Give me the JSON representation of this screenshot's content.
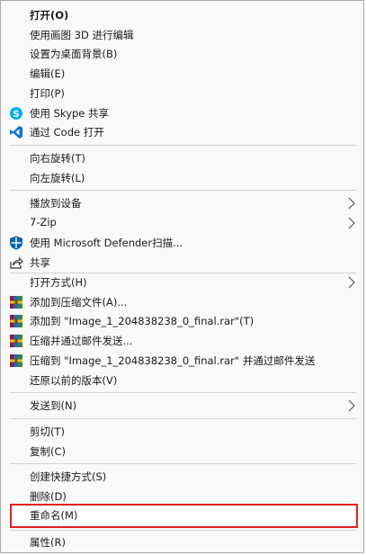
{
  "menu": {
    "items": [
      {
        "label": "打开(O)"
      },
      {
        "label": "使用画图 3D 进行编辑"
      },
      {
        "label": "设置为桌面背景(B)"
      },
      {
        "label": "编辑(E)"
      },
      {
        "label": "打印(P)"
      },
      {
        "label": "使用 Skype 共享",
        "icon": "skype-icon"
      },
      {
        "label": "通过 Code 打开",
        "icon": "vscode-icon"
      },
      {
        "label": "向右旋转(T)"
      },
      {
        "label": "向左旋转(L)"
      },
      {
        "label": "播放到设备",
        "submenu": true
      },
      {
        "label": "7-Zip",
        "submenu": true
      },
      {
        "label": "使用 Microsoft Defender扫描...",
        "icon": "defender-shield-icon"
      },
      {
        "label": "共享",
        "icon": "share-icon"
      },
      {
        "label": "打开方式(H)",
        "submenu": true
      },
      {
        "label": "添加到压缩文件(A)...",
        "icon": "winrar-icon"
      },
      {
        "label": "添加到 \"Image_1_204838238_0_final.rar\"(T)",
        "icon": "winrar-icon"
      },
      {
        "label": "压缩并通过邮件发送...",
        "icon": "winrar-icon"
      },
      {
        "label": "压缩到 \"Image_1_204838238_0_final.rar\" 并通过邮件发送",
        "icon": "winrar-icon"
      },
      {
        "label": "还原以前的版本(V)"
      },
      {
        "label": "发送到(N)",
        "submenu": true
      },
      {
        "label": "剪切(T)"
      },
      {
        "label": "复制(C)"
      },
      {
        "label": "创建快捷方式(S)"
      },
      {
        "label": "删除(D)"
      },
      {
        "label": "重命名(M)",
        "highlighted": true
      },
      {
        "label": "属性(R)"
      }
    ]
  },
  "colors": {
    "highlight_border": "#e02020",
    "separator": "#d4d4d4",
    "skype": "#00aff0",
    "vscode": "#0078d4",
    "defender": "#0063b1"
  }
}
